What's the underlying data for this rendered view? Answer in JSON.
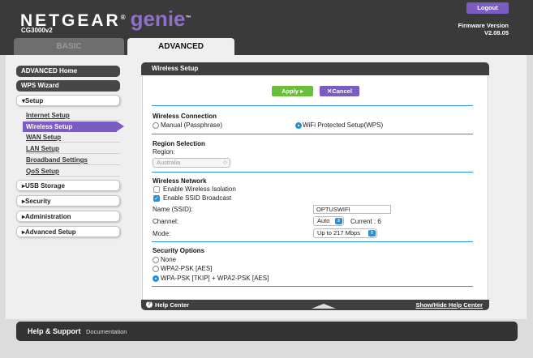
{
  "header": {
    "brand": "NETGEAR",
    "brand_reg": "®",
    "brand_genie": "genie",
    "brand_tm": "™",
    "model": "CG3000v2",
    "logout_label": "Logout",
    "firmware_label": "Firmware Version",
    "firmware_version": "V2.08.05",
    "tabs": [
      {
        "label": "BASIC",
        "active": false
      },
      {
        "label": "ADVANCED",
        "active": true
      }
    ]
  },
  "sidebar": {
    "advanced_home": "ADVANCED Home",
    "wps_wizard": "WPS Wizard",
    "setup": "Setup",
    "setup_items": [
      "Internet Setup",
      "Wireless Setup",
      "WAN Setup",
      "LAN Setup",
      "Broadband Settings",
      "QoS Setup"
    ],
    "active_item": "Wireless Setup",
    "sections": [
      "USB Storage",
      "Security",
      "Administration",
      "Advanced Setup"
    ]
  },
  "panel": {
    "title": "Wireless Setup",
    "apply_label": "Apply",
    "cancel_label": "Cancel",
    "wireless_connection": {
      "title": "Wireless Connection",
      "options": [
        "Manual (Passphrase)",
        "WiFi Protected Setup(WPS)"
      ],
      "selected": "WiFi Protected Setup(WPS)"
    },
    "region": {
      "title": "Region Selection",
      "label": "Region:",
      "value": "Australia"
    },
    "wireless_network": {
      "title": "Wireless Network",
      "isolation_label": "Enable Wireless Isolation",
      "isolation_checked": false,
      "broadcast_label": "Enable SSID Broadcast",
      "broadcast_checked": true,
      "ssid_label": "Name (SSID):",
      "ssid_value": "OPTUSWIFI",
      "channel_label": "Channel:",
      "channel_value": "Auto",
      "current_channel": "Current : 6",
      "mode_label": "Mode:",
      "mode_value": "Up to 217 Mbps"
    },
    "security": {
      "title": "Security Options",
      "options": [
        "None",
        "WPA2-PSK [AES]",
        "WPA-PSK [TKIP] + WPA2-PSK [AES]"
      ],
      "selected": "WPA-PSK [TKIP] + WPA2-PSK [AES]"
    },
    "footer": {
      "help_center": "Help Center",
      "show_hide": "Show/Hide Help Center"
    }
  },
  "bottom": {
    "help_support": "Help & Support",
    "documentation": "Documentation"
  },
  "colors": {
    "accent_purple": "#7b5cc1",
    "apply_green": "#6abf3a",
    "rule_blue": "#2a8fd6",
    "header_dark": "#3a3a3a"
  }
}
